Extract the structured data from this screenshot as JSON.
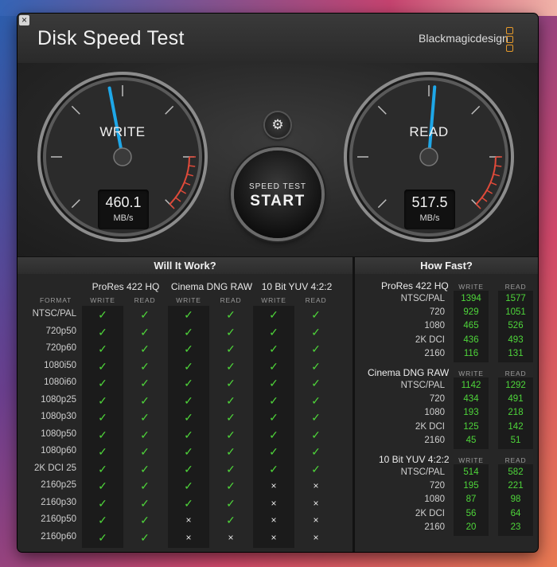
{
  "app": {
    "title": "Disk Speed Test",
    "brand": "Blackmagicdesign",
    "close_symbol": "×"
  },
  "gauges": {
    "write": {
      "label": "WRITE",
      "value": "460.1",
      "unit": "MB/s"
    },
    "read": {
      "label": "READ",
      "value": "517.5",
      "unit": "MB/s"
    }
  },
  "controls": {
    "start_top": "SPEED TEST",
    "start_main": "START",
    "settings_symbol": "⚙"
  },
  "will_it_work": {
    "heading": "Will It Work?",
    "format_header": "FORMAT",
    "codecs": [
      {
        "name": "ProRes 422 HQ",
        "sub": [
          "WRITE",
          "READ"
        ]
      },
      {
        "name": "Cinema DNG RAW",
        "sub": [
          "WRITE",
          "READ"
        ]
      },
      {
        "name": "10 Bit YUV 4:2:2",
        "sub": [
          "WRITE",
          "READ"
        ]
      }
    ],
    "symbols": {
      "yes": "✓",
      "no": "×"
    },
    "rows": [
      {
        "format": "NTSC/PAL",
        "cells": [
          1,
          1,
          1,
          1,
          1,
          1
        ]
      },
      {
        "format": "720p50",
        "cells": [
          1,
          1,
          1,
          1,
          1,
          1
        ]
      },
      {
        "format": "720p60",
        "cells": [
          1,
          1,
          1,
          1,
          1,
          1
        ]
      },
      {
        "format": "1080i50",
        "cells": [
          1,
          1,
          1,
          1,
          1,
          1
        ]
      },
      {
        "format": "1080i60",
        "cells": [
          1,
          1,
          1,
          1,
          1,
          1
        ]
      },
      {
        "format": "1080p25",
        "cells": [
          1,
          1,
          1,
          1,
          1,
          1
        ]
      },
      {
        "format": "1080p30",
        "cells": [
          1,
          1,
          1,
          1,
          1,
          1
        ]
      },
      {
        "format": "1080p50",
        "cells": [
          1,
          1,
          1,
          1,
          1,
          1
        ]
      },
      {
        "format": "1080p60",
        "cells": [
          1,
          1,
          1,
          1,
          1,
          1
        ]
      },
      {
        "format": "2K DCI 25",
        "cells": [
          1,
          1,
          1,
          1,
          1,
          1
        ]
      },
      {
        "format": "2160p25",
        "cells": [
          1,
          1,
          1,
          1,
          0,
          0
        ]
      },
      {
        "format": "2160p30",
        "cells": [
          1,
          1,
          1,
          1,
          0,
          0
        ]
      },
      {
        "format": "2160p50",
        "cells": [
          1,
          1,
          0,
          1,
          0,
          0
        ]
      },
      {
        "format": "2160p60",
        "cells": [
          1,
          1,
          0,
          0,
          0,
          0
        ]
      }
    ]
  },
  "how_fast": {
    "heading": "How Fast?",
    "groups": [
      {
        "codec": "ProRes 422 HQ",
        "sub": [
          "WRITE",
          "READ"
        ],
        "rows": [
          {
            "format": "NTSC/PAL",
            "write": "1394",
            "read": "1577"
          },
          {
            "format": "720",
            "write": "929",
            "read": "1051"
          },
          {
            "format": "1080",
            "write": "465",
            "read": "526"
          },
          {
            "format": "2K DCI",
            "write": "436",
            "read": "493"
          },
          {
            "format": "2160",
            "write": "116",
            "read": "131"
          }
        ]
      },
      {
        "codec": "Cinema DNG RAW",
        "sub": [
          "WRITE",
          "READ"
        ],
        "rows": [
          {
            "format": "NTSC/PAL",
            "write": "1142",
            "read": "1292"
          },
          {
            "format": "720",
            "write": "434",
            "read": "491"
          },
          {
            "format": "1080",
            "write": "193",
            "read": "218"
          },
          {
            "format": "2K DCI",
            "write": "125",
            "read": "142"
          },
          {
            "format": "2160",
            "write": "45",
            "read": "51"
          }
        ]
      },
      {
        "codec": "10 Bit YUV 4:2:2",
        "sub": [
          "WRITE",
          "READ"
        ],
        "rows": [
          {
            "format": "NTSC/PAL",
            "write": "514",
            "read": "582"
          },
          {
            "format": "720",
            "write": "195",
            "read": "221"
          },
          {
            "format": "1080",
            "write": "87",
            "read": "98"
          },
          {
            "format": "2K DCI",
            "write": "56",
            "read": "64"
          },
          {
            "format": "2160",
            "write": "20",
            "read": "23"
          }
        ]
      }
    ]
  },
  "colors": {
    "accent_green": "#4ed53a",
    "needle_blue": "#1ea7e8",
    "redline": "#e04a3a",
    "brand_orange": "#e69a2a"
  }
}
